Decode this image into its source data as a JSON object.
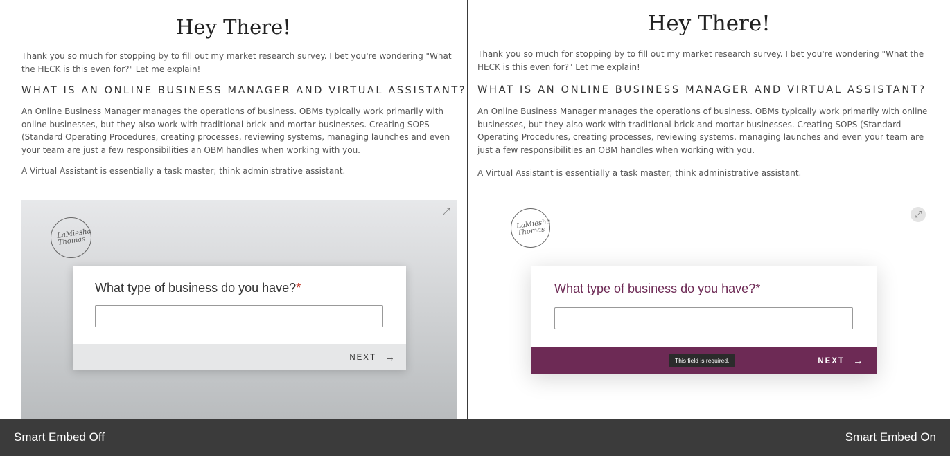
{
  "page": {
    "title": "Hey There!",
    "intro": "Thank you so much for stopping by to fill out my market research survey. I bet you're wondering \"What the HECK is this even for?\" Let me explain!",
    "heading": "WHAT IS AN ONLINE BUSINESS MANAGER AND VIRTUAL ASSISTANT?",
    "obm_paragraph": "An Online Business Manager manages the operations of business. OBMs typically work primarily with online businesses, but they also work with traditional brick and mortar businesses. Creating SOPS (Standard Operating Procedures, creating processes, reviewing systems, managing launches and even your team are just a few responsibilities an OBM handles when working with you.",
    "va_paragraph": "A Virtual Assistant is essentially a task master; think administrative assistant."
  },
  "form": {
    "logo_text": "LaMiesha Thomas",
    "question": "What type of business do you have?",
    "required_mark": "*",
    "input_value": "",
    "next_label": "NEXT",
    "next_arrow": "→",
    "expand_icon": "⤢",
    "tooltip": "This field is required."
  },
  "labels": {
    "left": "Smart Embed Off",
    "right": "Smart Embed On"
  },
  "colors": {
    "brand_plum": "#6d2a55",
    "question_plum": "#6d2a55",
    "footer_gray": "#e6e7e8",
    "bar_dark": "#3b3b3b"
  }
}
